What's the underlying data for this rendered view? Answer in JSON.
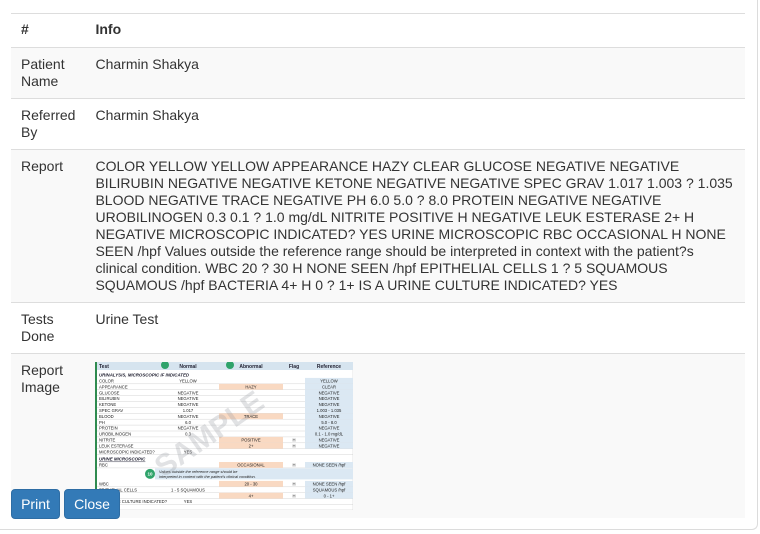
{
  "table": {
    "header": {
      "col1": "#",
      "col2": "Info"
    },
    "patient_name": {
      "label": "Patient Name",
      "value": "Charmin Shakya"
    },
    "referred_by": {
      "label": "Referred By",
      "value": "Charmin Shakya"
    },
    "report": {
      "label": "Report",
      "value": "COLOR YELLOW YELLOW APPEARANCE HAZY CLEAR GLUCOSE NEGATIVE NEGATIVE BILIRUBIN NEGATIVE NEGATIVE KETONE NEGATIVE NEGATIVE SPEC GRAV 1.017 1.003 ? 1.035 BLOOD NEGATIVE TRACE NEGATIVE PH 6.0 5.0 ? 8.0 PROTEIN NEGATIVE NEGATIVE UROBILINOGEN 0.3 0.1 ? 1.0 mg/dL NITRITE POSITIVE H NEGATIVE LEUK ESTERASE 2+ H NEGATIVE MICROSCOPIC INDICATED? YES URINE MICROSCOPIC RBC OCCASIONAL H NONE SEEN /hpf Values outside the reference range should be interpreted in context with the patient?s clinical condition. WBC 20 ? 30 H NONE SEEN /hpf EPITHELIAL CELLS 1 ? 5 SQUAMOUS SQUAMOUS /hpf BACTERIA 4+ H 0 ? 1+ IS A URINE CULTURE INDICATED? YES"
    },
    "tests_done": {
      "label": "Tests Done",
      "value": "Urine Test"
    },
    "report_image": {
      "label": "Report Image"
    }
  },
  "report_image": {
    "watermark": "SAMPLE",
    "headers": [
      "Test",
      "Normal",
      "Abnormal",
      "Flag",
      "Reference"
    ],
    "section1": "URINALYSIS, MICROSCOPIC IF INDICATED",
    "rows": [
      [
        "COLOR",
        "YELLOW",
        "",
        "",
        "YELLOW"
      ],
      [
        "APPEARANCE",
        "",
        "HAZY",
        "",
        "CLEAR"
      ],
      [
        "GLUCOSE",
        "NEGATIVE",
        "",
        "",
        "NEGATIVE"
      ],
      [
        "BILIRUBIN",
        "NEGATIVE",
        "",
        "",
        "NEGATIVE"
      ],
      [
        "KETONE",
        "NEGATIVE",
        "",
        "",
        "NEGATIVE"
      ],
      [
        "SPEC GRAV",
        "1.017",
        "",
        "",
        "1.003 - 1.035"
      ],
      [
        "BLOOD",
        "NEGATIVE",
        "TRACE",
        "",
        "NEGATIVE"
      ],
      [
        "PH",
        "6.0",
        "",
        "",
        "5.0 - 8.0"
      ],
      [
        "PROTEIN",
        "NEGATIVE",
        "",
        "",
        "NEGATIVE"
      ],
      [
        "UROBILINOGEN",
        "0.3",
        "",
        "",
        "0.1 - 1.0 mg/dL"
      ],
      [
        "NITRITE",
        "",
        "POSITIVE",
        "H",
        "NEGATIVE"
      ],
      [
        "LEUK ESTERASE",
        "",
        "2+",
        "H",
        "NEGATIVE"
      ],
      [
        "MICROSCOPIC INDICATED?",
        "YES",
        "",
        "",
        ""
      ]
    ],
    "section2": "URINE MICROSCOPIC",
    "rows2": [
      [
        "RBC",
        "",
        "OCCASIONAL",
        "H",
        "NONE SEEN /hpf"
      ]
    ],
    "note_number": "10",
    "note": "Values outside the reference range should be interpreted in context with the patient's clinical condition.",
    "rows3": [
      [
        "WBC",
        "",
        "20 - 30",
        "H",
        "NONE SEEN /hpf"
      ],
      [
        "EPITHELIAL CELLS",
        "1 - 5 SQUAMOUS",
        "",
        "",
        "SQUAMOUS /hpf"
      ],
      [
        "BACTERIA",
        "",
        "4+",
        "H",
        "0 - 1+"
      ],
      [
        "IS A URINE CULTURE INDICATED?",
        "YES",
        "",
        "",
        ""
      ]
    ]
  },
  "buttons": {
    "print": "Print",
    "close": "Close"
  },
  "colors": {
    "primary": "#337ab7",
    "abnormal_bg": "#f9d9c2",
    "reference_bg": "#dbe8f3",
    "accent_green": "#2fa36b"
  }
}
